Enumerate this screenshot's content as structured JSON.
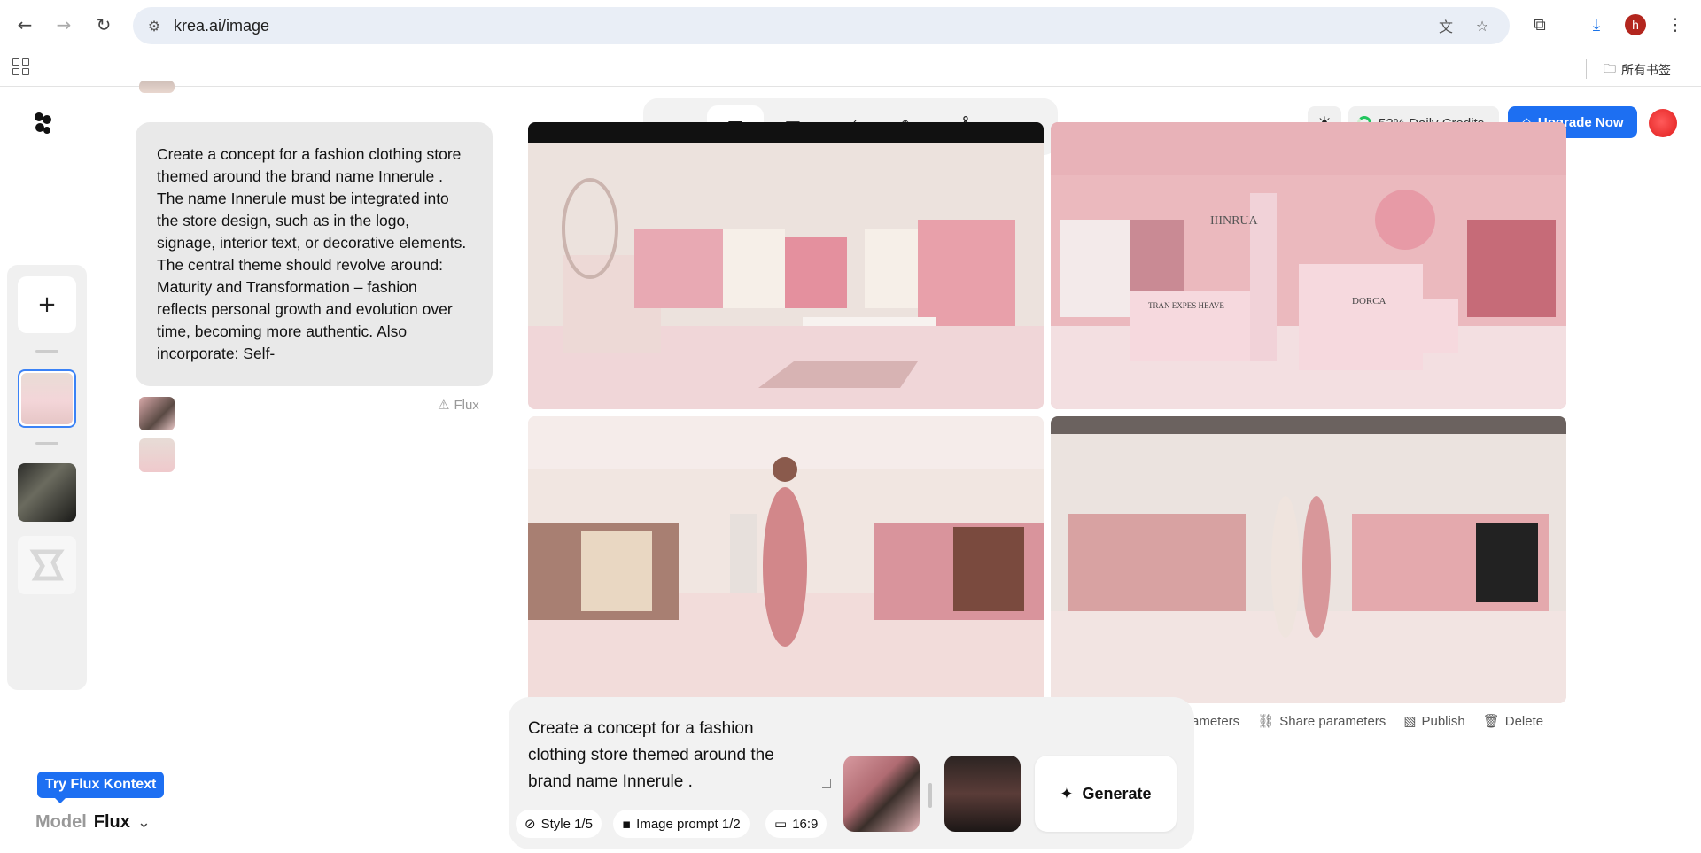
{
  "browser": {
    "url": "krea.ai/image",
    "profile_initial": "h",
    "bookmarks_folder": "所有书签"
  },
  "toolbar": {
    "tools": [
      "home-icon",
      "image-icon",
      "video-icon",
      "enhance-icon",
      "edit-icon",
      "train-icon",
      "assets-icon"
    ],
    "active_tool": "image-icon"
  },
  "header": {
    "credits": "52% Daily Credits",
    "upgrade_label": "Upgrade Now"
  },
  "history": {
    "prompt": "Create a concept for a fashion clothing store themed around the brand name Innerule . The name Innerule must be integrated into the store design, such as in the logo, signage, interior text, or decorative elements. The central theme should revolve around: Maturity and Transformation – fashion reflects personal growth and evolution over time, becoming more authentic. Also incorporate: Self-",
    "model_tag": "Flux"
  },
  "images": {
    "sign_top": "IIINRUA",
    "counter_left": "TRAN EXPES HEAVE",
    "counter_right": "DORCA"
  },
  "actions": {
    "reuse": "rameters",
    "share": "Share parameters",
    "publish": "Publish",
    "delete": "Delete"
  },
  "composer": {
    "prompt": "Create a concept for a fashion clothing store themed around the brand name Innerule .",
    "style_chip": "Style 1/5",
    "image_prompt_chip": "Image prompt 1/2",
    "aspect_chip": "16:9",
    "generate_label": "Generate"
  },
  "model": {
    "badge": "Try Flux Kontext",
    "label": "Model",
    "value": "Flux"
  },
  "colors": {
    "accent": "#1d6ff2",
    "selected_border": "#3b82f6"
  }
}
